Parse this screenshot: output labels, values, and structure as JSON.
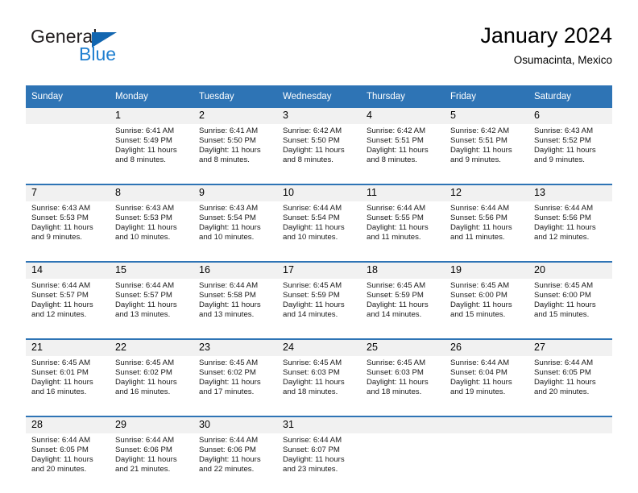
{
  "logo": {
    "word_one": "General",
    "word_two": "Blue",
    "triangle_icon": "blue-triangle-icon",
    "accent_color": "#1f7fd0"
  },
  "header": {
    "title": "January 2024",
    "subtitle": "Osumacinta, Mexico"
  },
  "theme": {
    "header_blue": "#2e74b5",
    "daynum_band": "#f1f1f1",
    "body_bg": "#ffffff"
  },
  "weekday_headers": [
    "Sunday",
    "Monday",
    "Tuesday",
    "Wednesday",
    "Thursday",
    "Friday",
    "Saturday"
  ],
  "weeks": [
    [
      {
        "day": "",
        "lines": [
          "",
          "",
          "",
          ""
        ]
      },
      {
        "day": "1",
        "lines": [
          "Sunrise: 6:41 AM",
          "Sunset: 5:49 PM",
          "Daylight: 11 hours",
          "and 8 minutes."
        ]
      },
      {
        "day": "2",
        "lines": [
          "Sunrise: 6:41 AM",
          "Sunset: 5:50 PM",
          "Daylight: 11 hours",
          "and 8 minutes."
        ]
      },
      {
        "day": "3",
        "lines": [
          "Sunrise: 6:42 AM",
          "Sunset: 5:50 PM",
          "Daylight: 11 hours",
          "and 8 minutes."
        ]
      },
      {
        "day": "4",
        "lines": [
          "Sunrise: 6:42 AM",
          "Sunset: 5:51 PM",
          "Daylight: 11 hours",
          "and 8 minutes."
        ]
      },
      {
        "day": "5",
        "lines": [
          "Sunrise: 6:42 AM",
          "Sunset: 5:51 PM",
          "Daylight: 11 hours",
          "and 9 minutes."
        ]
      },
      {
        "day": "6",
        "lines": [
          "Sunrise: 6:43 AM",
          "Sunset: 5:52 PM",
          "Daylight: 11 hours",
          "and 9 minutes."
        ]
      }
    ],
    [
      {
        "day": "7",
        "lines": [
          "Sunrise: 6:43 AM",
          "Sunset: 5:53 PM",
          "Daylight: 11 hours",
          "and 9 minutes."
        ]
      },
      {
        "day": "8",
        "lines": [
          "Sunrise: 6:43 AM",
          "Sunset: 5:53 PM",
          "Daylight: 11 hours",
          "and 10 minutes."
        ]
      },
      {
        "day": "9",
        "lines": [
          "Sunrise: 6:43 AM",
          "Sunset: 5:54 PM",
          "Daylight: 11 hours",
          "and 10 minutes."
        ]
      },
      {
        "day": "10",
        "lines": [
          "Sunrise: 6:44 AM",
          "Sunset: 5:54 PM",
          "Daylight: 11 hours",
          "and 10 minutes."
        ]
      },
      {
        "day": "11",
        "lines": [
          "Sunrise: 6:44 AM",
          "Sunset: 5:55 PM",
          "Daylight: 11 hours",
          "and 11 minutes."
        ]
      },
      {
        "day": "12",
        "lines": [
          "Sunrise: 6:44 AM",
          "Sunset: 5:56 PM",
          "Daylight: 11 hours",
          "and 11 minutes."
        ]
      },
      {
        "day": "13",
        "lines": [
          "Sunrise: 6:44 AM",
          "Sunset: 5:56 PM",
          "Daylight: 11 hours",
          "and 12 minutes."
        ]
      }
    ],
    [
      {
        "day": "14",
        "lines": [
          "Sunrise: 6:44 AM",
          "Sunset: 5:57 PM",
          "Daylight: 11 hours",
          "and 12 minutes."
        ]
      },
      {
        "day": "15",
        "lines": [
          "Sunrise: 6:44 AM",
          "Sunset: 5:57 PM",
          "Daylight: 11 hours",
          "and 13 minutes."
        ]
      },
      {
        "day": "16",
        "lines": [
          "Sunrise: 6:44 AM",
          "Sunset: 5:58 PM",
          "Daylight: 11 hours",
          "and 13 minutes."
        ]
      },
      {
        "day": "17",
        "lines": [
          "Sunrise: 6:45 AM",
          "Sunset: 5:59 PM",
          "Daylight: 11 hours",
          "and 14 minutes."
        ]
      },
      {
        "day": "18",
        "lines": [
          "Sunrise: 6:45 AM",
          "Sunset: 5:59 PM",
          "Daylight: 11 hours",
          "and 14 minutes."
        ]
      },
      {
        "day": "19",
        "lines": [
          "Sunrise: 6:45 AM",
          "Sunset: 6:00 PM",
          "Daylight: 11 hours",
          "and 15 minutes."
        ]
      },
      {
        "day": "20",
        "lines": [
          "Sunrise: 6:45 AM",
          "Sunset: 6:00 PM",
          "Daylight: 11 hours",
          "and 15 minutes."
        ]
      }
    ],
    [
      {
        "day": "21",
        "lines": [
          "Sunrise: 6:45 AM",
          "Sunset: 6:01 PM",
          "Daylight: 11 hours",
          "and 16 minutes."
        ]
      },
      {
        "day": "22",
        "lines": [
          "Sunrise: 6:45 AM",
          "Sunset: 6:02 PM",
          "Daylight: 11 hours",
          "and 16 minutes."
        ]
      },
      {
        "day": "23",
        "lines": [
          "Sunrise: 6:45 AM",
          "Sunset: 6:02 PM",
          "Daylight: 11 hours",
          "and 17 minutes."
        ]
      },
      {
        "day": "24",
        "lines": [
          "Sunrise: 6:45 AM",
          "Sunset: 6:03 PM",
          "Daylight: 11 hours",
          "and 18 minutes."
        ]
      },
      {
        "day": "25",
        "lines": [
          "Sunrise: 6:45 AM",
          "Sunset: 6:03 PM",
          "Daylight: 11 hours",
          "and 18 minutes."
        ]
      },
      {
        "day": "26",
        "lines": [
          "Sunrise: 6:44 AM",
          "Sunset: 6:04 PM",
          "Daylight: 11 hours",
          "and 19 minutes."
        ]
      },
      {
        "day": "27",
        "lines": [
          "Sunrise: 6:44 AM",
          "Sunset: 6:05 PM",
          "Daylight: 11 hours",
          "and 20 minutes."
        ]
      }
    ],
    [
      {
        "day": "28",
        "lines": [
          "Sunrise: 6:44 AM",
          "Sunset: 6:05 PM",
          "Daylight: 11 hours",
          "and 20 minutes."
        ]
      },
      {
        "day": "29",
        "lines": [
          "Sunrise: 6:44 AM",
          "Sunset: 6:06 PM",
          "Daylight: 11 hours",
          "and 21 minutes."
        ]
      },
      {
        "day": "30",
        "lines": [
          "Sunrise: 6:44 AM",
          "Sunset: 6:06 PM",
          "Daylight: 11 hours",
          "and 22 minutes."
        ]
      },
      {
        "day": "31",
        "lines": [
          "Sunrise: 6:44 AM",
          "Sunset: 6:07 PM",
          "Daylight: 11 hours",
          "and 23 minutes."
        ]
      },
      {
        "day": "",
        "lines": [
          "",
          "",
          "",
          ""
        ]
      },
      {
        "day": "",
        "lines": [
          "",
          "",
          "",
          ""
        ]
      },
      {
        "day": "",
        "lines": [
          "",
          "",
          "",
          ""
        ]
      }
    ]
  ]
}
